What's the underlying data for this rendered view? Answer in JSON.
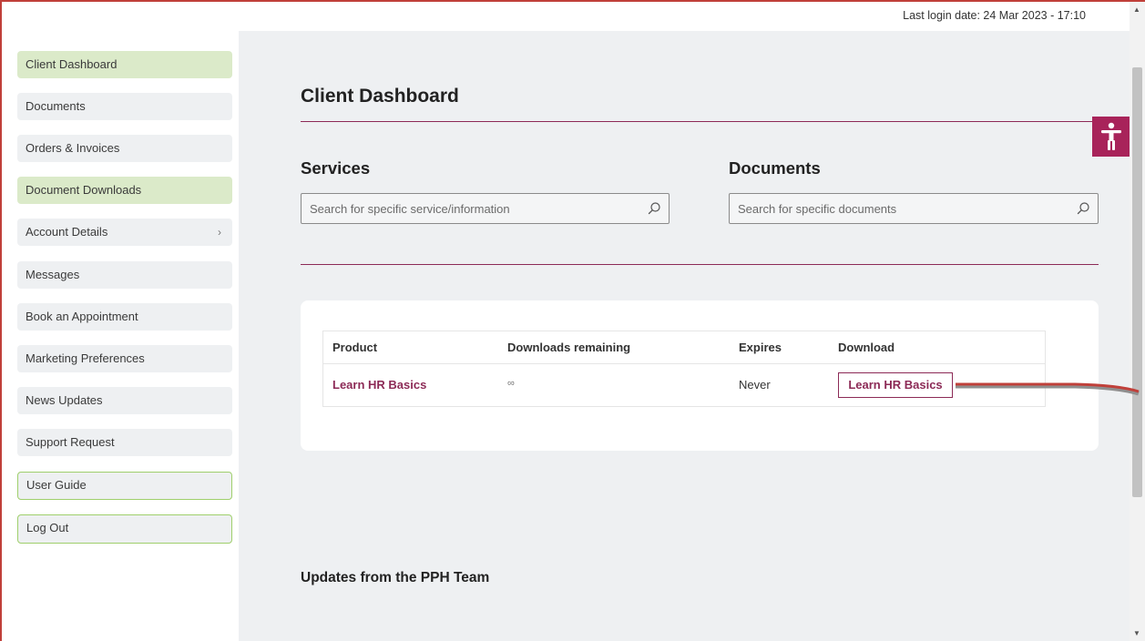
{
  "header": {
    "last_login": "Last login date: 24 Mar 2023 - 17:10"
  },
  "sidebar": {
    "items": [
      {
        "label": "Client Dashboard",
        "state": "active"
      },
      {
        "label": "Documents"
      },
      {
        "label": "Orders & Invoices"
      },
      {
        "label": "Document Downloads",
        "state": "active"
      },
      {
        "label": "Account Details",
        "has_submenu": true,
        "chevron": "›"
      },
      {
        "label": "Messages"
      },
      {
        "label": "Book an Appointment"
      },
      {
        "label": "Marketing Preferences"
      },
      {
        "label": "News Updates"
      },
      {
        "label": "Support Request"
      },
      {
        "label": "User Guide",
        "style": "outlined"
      },
      {
        "label": "Log Out",
        "style": "outlined"
      }
    ]
  },
  "main": {
    "page_title": "Client Dashboard",
    "services": {
      "title": "Services",
      "search_placeholder": "Search for specific service/information",
      "search_value": ""
    },
    "documents": {
      "title": "Documents",
      "search_placeholder": "Search for specific documents",
      "search_value": ""
    },
    "downloads_table": {
      "columns": [
        "Product",
        "Downloads remaining",
        "Expires",
        "Download"
      ],
      "rows": [
        {
          "product": "Learn HR Basics",
          "downloads_remaining": "∞",
          "expires": "Never",
          "download_button": "Learn HR Basics"
        }
      ]
    },
    "updates_title": "Updates from the PPH Team"
  },
  "icons": {
    "search": "search-icon",
    "accessibility": "accessibility-icon",
    "chevron": "chevron-right-icon"
  },
  "colors": {
    "brand": "#8c2a56",
    "accessibility_button": "#a8235a",
    "nav_active": "#dbeac9",
    "nav_outline": "#9fcf6c",
    "main_bg": "#eef0f2",
    "annotation_arrow": "#c0403a"
  }
}
